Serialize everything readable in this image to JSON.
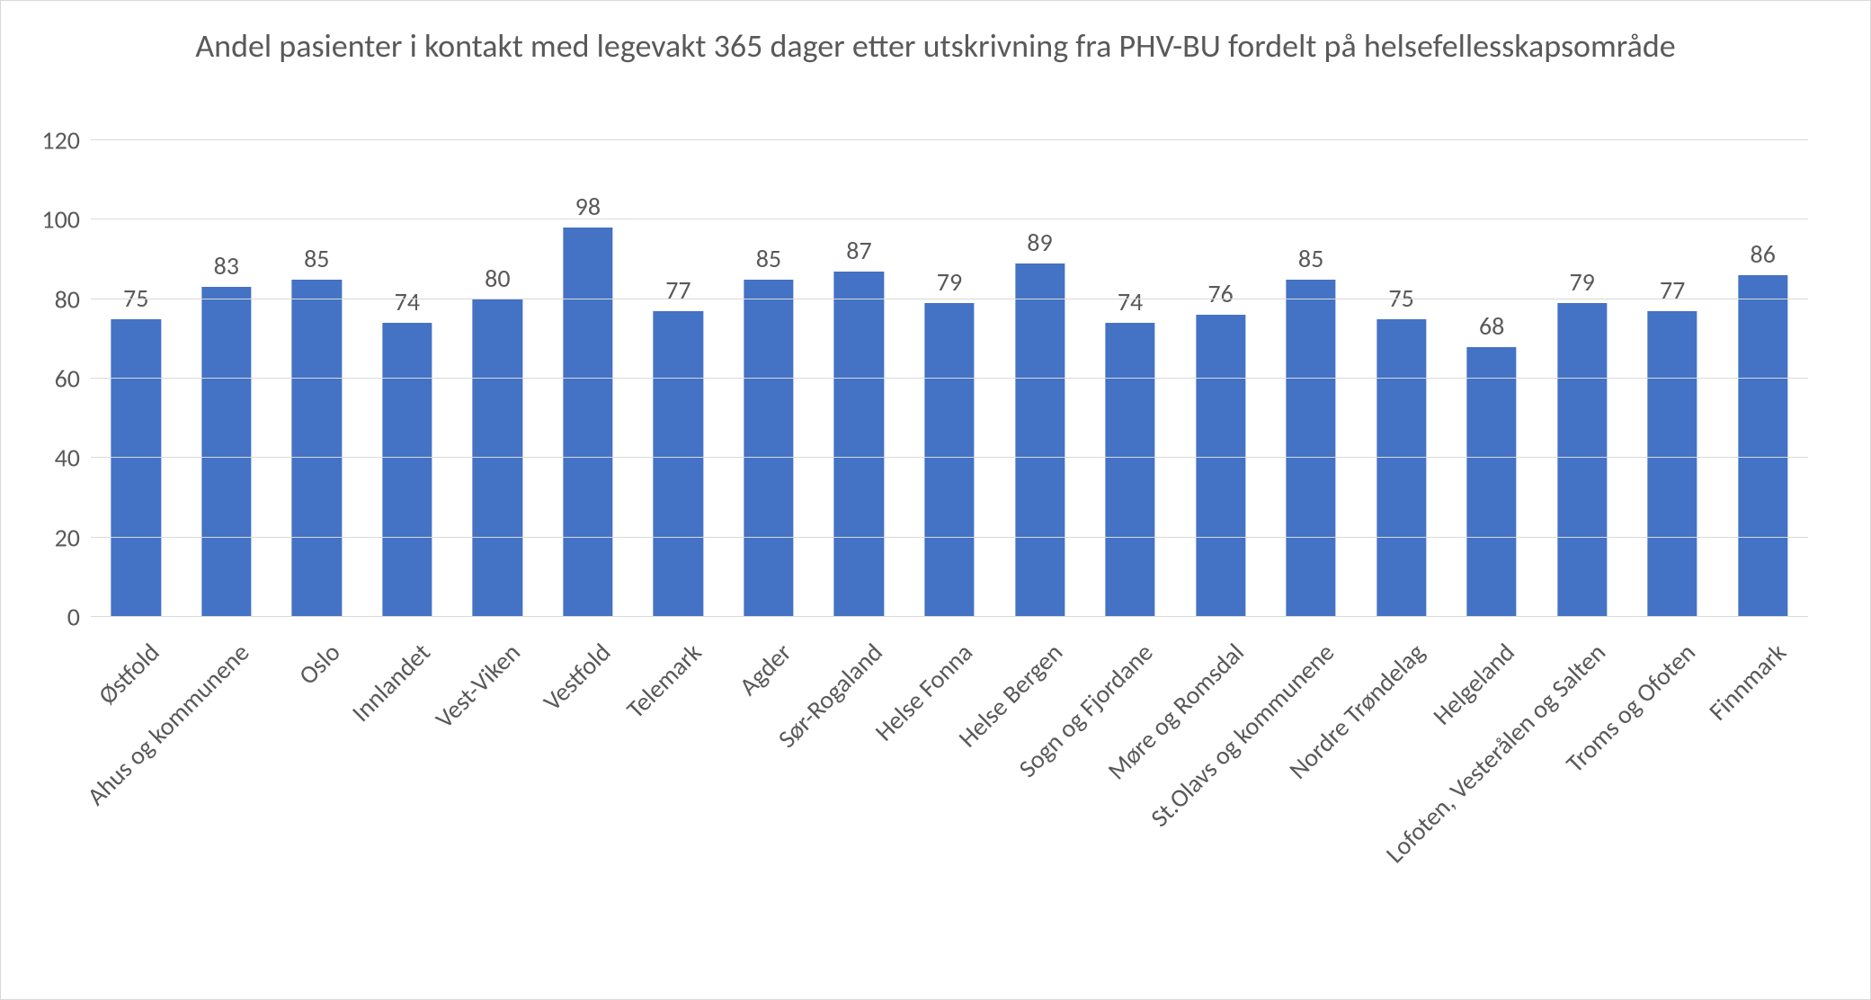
{
  "chart_data": {
    "type": "bar",
    "title": "Andel pasienter i kontakt med legevakt 365 dager etter utskrivning fra PHV-BU fordelt på helsefellesskapsområde",
    "xlabel": "",
    "ylabel": "",
    "ylim": [
      0,
      120
    ],
    "y_ticks": [
      0,
      20,
      40,
      60,
      80,
      100,
      120
    ],
    "categories": [
      "Østfold",
      "Ahus og kommunene",
      "Oslo",
      "Innlandet",
      "Vest-Viken",
      "Vestfold",
      "Telemark",
      "Agder",
      "Sør-Rogaland",
      "Helse Fonna",
      "Helse Bergen",
      "Sogn og Fjordane",
      "Møre og Romsdal",
      "St.Olavs og kommunene",
      "Nordre Trøndelag",
      "Helgeland",
      "Lofoten, Vesterålen og Salten",
      "Troms og Ofoten",
      "Finnmark"
    ],
    "values": [
      75,
      83,
      85,
      74,
      80,
      98,
      77,
      85,
      87,
      79,
      89,
      74,
      76,
      85,
      75,
      68,
      79,
      77,
      86
    ],
    "bar_color": "#4472c4"
  }
}
